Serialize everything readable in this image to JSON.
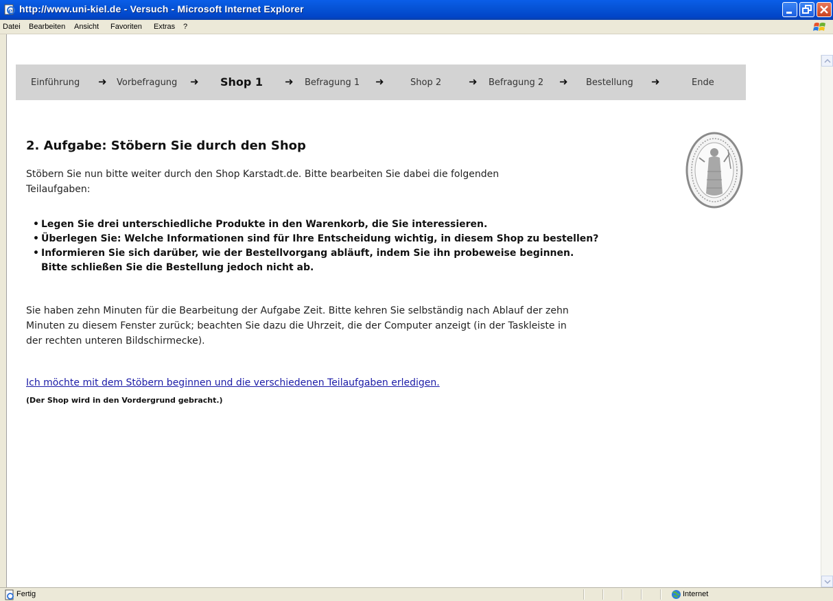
{
  "window": {
    "title": "http://www.uni-kiel.de - Versuch - Microsoft Internet Explorer",
    "accent_color": "#0653d6"
  },
  "menu": {
    "items": [
      "Datei",
      "Bearbeiten",
      "Ansicht",
      "Favoriten",
      "Extras",
      "?"
    ]
  },
  "steps": {
    "items": [
      "Einführung",
      "Vorbefragung",
      "Shop 1",
      "Befragung 1",
      "Shop 2",
      "Befragung 2",
      "Bestellung",
      "Ende"
    ],
    "current": "Shop 1",
    "arrow": "➜"
  },
  "page": {
    "heading": "2. Aufgabe: Stöbern Sie durch den Shop",
    "intro_line1": "Stöbern Sie nun bitte weiter durch den Shop Karstadt.de. Bitte bearbeiten Sie dabei die folgenden",
    "intro_line2": "Teilaufgaben:",
    "tasks": [
      "Legen Sie drei unterschiedliche Produkte in den Warenkorb, die Sie interessieren.",
      "Überlegen Sie: Welche Informationen sind für Ihre Entscheidung wichtig, in diesem Shop zu bestellen?",
      "Informieren Sie sich darüber, wie der Bestellvorgang abläuft, indem Sie ihn probeweise beginnen.",
      "Bitte schließen Sie die Bestellung jedoch nicht ab."
    ],
    "time_line1": "Sie haben zehn Minuten für die Bearbeitung der Aufgabe Zeit. Bitte kehren Sie selbständig nach Ablauf der zehn",
    "time_line2": "Minuten zu diesem Fenster zurück; beachten Sie dazu die Uhrzeit, die der Computer anzeigt (in der Taskleiste in",
    "time_line3": "der rechten unteren Bildschirmecke).",
    "start_link": "Ich möchte mit dem Stöbern beginnen und die verschiedenen Teilaufgaben erledigen.",
    "start_note": "(Der Shop wird in den Vordergrund gebracht.)",
    "link_color": "#1a1aa6"
  },
  "status": {
    "text": "Fertig",
    "zone": "Internet"
  }
}
